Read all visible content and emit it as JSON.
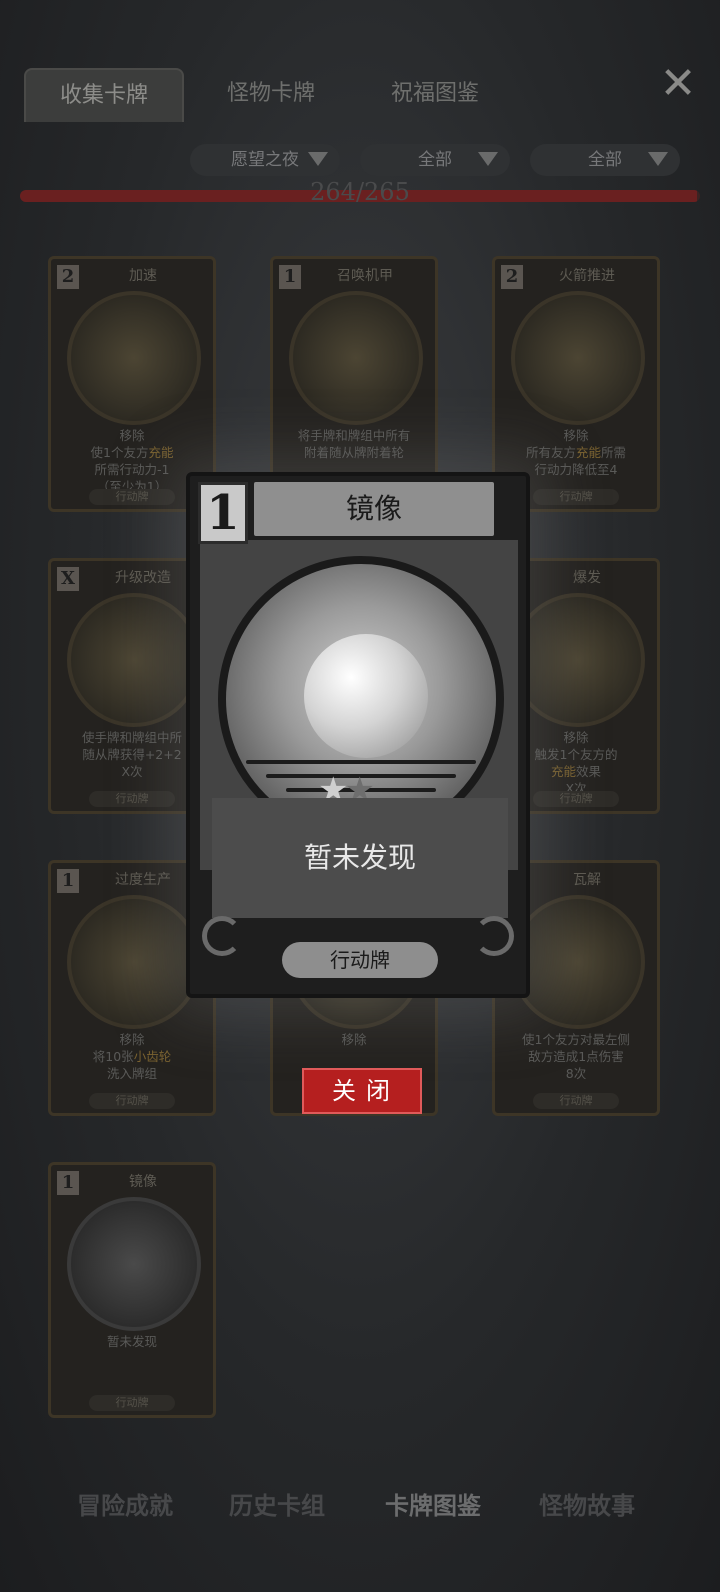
{
  "tabs": [
    "收集卡牌",
    "怪物卡牌",
    "祝福图鉴"
  ],
  "filters": [
    "愿望之夜",
    "全部",
    "全部"
  ],
  "progress": {
    "text": "264/265",
    "value": 264,
    "max": 265
  },
  "cards": [
    {
      "cost": "2",
      "name": "加速",
      "desc_pre": "移除\n使1个友方",
      "desc_hl": "充能",
      "desc_post": "\n所需行动力-1\n（至少为1）",
      "type": "行动牌"
    },
    {
      "cost": "1",
      "name": "召唤机甲",
      "desc_pre": "将手牌和牌组中所有\n附着随从牌附着轮",
      "desc_hl": "",
      "desc_post": "",
      "type": ""
    },
    {
      "cost": "2",
      "name": "火箭推进",
      "desc_pre": "移除\n所有友方",
      "desc_hl": "充能",
      "desc_post": "所需\n行动力降低至4",
      "type": "行动牌"
    },
    {
      "cost": "X",
      "name": "升级改造",
      "desc_pre": "使手牌和牌组中所\n随从牌获得+2+2\nX次",
      "desc_hl": "",
      "desc_post": "",
      "type": "行动牌"
    },
    {
      "cost": "",
      "name": "爆发",
      "desc_pre": "移除\n触发1个友方的\n",
      "desc_hl": "充能",
      "desc_post": "效果\nX次",
      "type": "行动牌"
    },
    {
      "cost": "1",
      "name": "过度生产",
      "desc_pre": "移除\n将10张",
      "desc_hl": "小齿轮",
      "desc_post": "\n洗入牌组",
      "type": "行动牌"
    },
    {
      "cost": "",
      "name": "",
      "desc_pre": "移除",
      "desc_hl": "",
      "desc_post": "",
      "type": ""
    },
    {
      "cost": "",
      "name": "瓦解",
      "desc_pre": "使1个友方对最左侧\n敌方造成1点伤害\n8次",
      "desc_hl": "",
      "desc_post": "",
      "type": "行动牌"
    },
    {
      "cost": "1",
      "name": "镜像",
      "desc_pre": "暂未发现",
      "desc_hl": "",
      "desc_post": "",
      "type": "行动牌"
    }
  ],
  "modal": {
    "cost": "1",
    "title": "镜像",
    "desc": "暂未发现",
    "type": "行动牌",
    "stars": 2
  },
  "close_button": "关闭",
  "bottom_nav": [
    "冒险成就",
    "历史卡组",
    "卡牌图鉴",
    "怪物故事"
  ]
}
